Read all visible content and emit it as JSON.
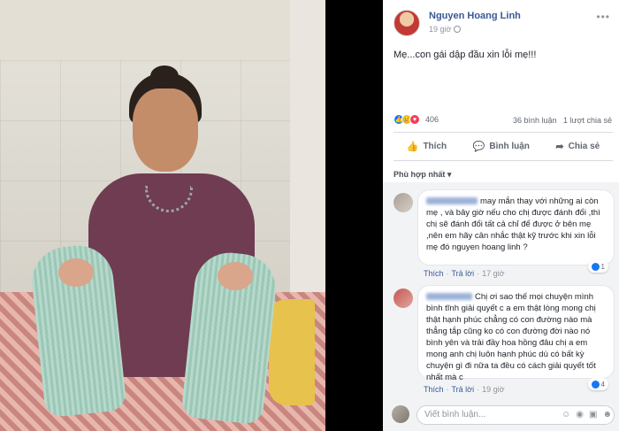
{
  "post": {
    "author": "Nguyen Hoang Linh",
    "time": "19 giờ",
    "text": "Mẹ...con gái dập đầu xin lỗi mẹ!!!",
    "reaction_count": "406",
    "comment_count": "36 bình luận",
    "share_count": "1 lượt chia sẻ",
    "actions": {
      "like": "Thích",
      "comment": "Bình luận",
      "share": "Chia sẻ"
    },
    "sort_label": "Phù hợp nhất ▾"
  },
  "comments": [
    {
      "text": "may mắn thay với những ai còn mẹ , và bây giờ nếu cho chị được đánh đổi ,thì chị sẽ đánh đổi tất cả chỉ để được ở bên mẹ ,nên em hãy cân nhắc thật kỹ trước khi xin lỗi mẹ đó nguyen hoang linh ?",
      "like": "Thích",
      "reply": "Trả lời",
      "time": "17 giờ",
      "reactions": "1"
    },
    {
      "text": "Chị ơi sao thế mọi chuyện mình bình tĩnh giải quyết c a em thật lòng mong chị thật hạnh phúc chẳng có con đường nào mà thẳng tắp cũng ko có con đường đời nào nó bình yên và trải đầy hoa hồng đâu chị a em mong anh chị luôn hạnh phúc dù có bất kỳ chuyện gì đi nữa ta đều có cách giải quyết tốt nhất mà c",
      "like": "Thích",
      "reply": "Trả lời",
      "time": "19 giờ",
      "reactions": "4"
    }
  ],
  "composer": {
    "placeholder": "Viết bình luận..."
  },
  "colors": {
    "link": "#385898",
    "like_blue": "#1877f2",
    "love_red": "#f33e58",
    "sad_yellow": "#f7b125"
  }
}
